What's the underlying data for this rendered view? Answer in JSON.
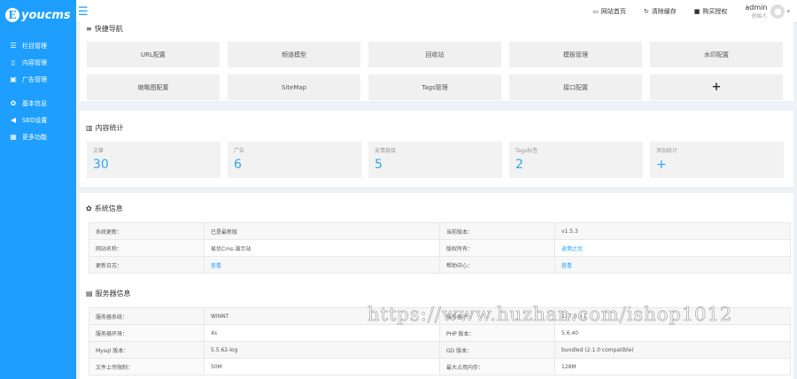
{
  "app": {
    "logo_letter": "E",
    "logo_text": "youcms"
  },
  "sidebar": {
    "group1": [
      {
        "icon": "list-icon",
        "label": "栏目管理"
      },
      {
        "icon": "file-icon",
        "label": "内容管理"
      },
      {
        "icon": "image-icon",
        "label": "广告管理"
      }
    ],
    "group2": [
      {
        "icon": "gear-icon",
        "label": "基本信息"
      },
      {
        "icon": "send-icon",
        "label": "SEO设置"
      },
      {
        "icon": "grid-icon",
        "label": "更多功能"
      }
    ]
  },
  "topbar": {
    "links": [
      {
        "icon": "monitor-icon",
        "label": "网站首页"
      },
      {
        "icon": "refresh-icon",
        "label": "清除缓存"
      },
      {
        "icon": "bookmark-icon",
        "label": "购买授权"
      }
    ],
    "user": {
      "name": "admin",
      "role": "创始人"
    }
  },
  "quick_nav": {
    "title": "快捷导航",
    "items": [
      "URL配置",
      "频道模型",
      "回收站",
      "模板管理",
      "水印配置",
      "缩略图配置",
      "SiteMap",
      "Tags管理",
      "接口配置",
      "+"
    ]
  },
  "content_stats": {
    "title": "内容统计",
    "cards": [
      {
        "label": "文章",
        "value": "30"
      },
      {
        "label": "广告",
        "value": "6"
      },
      {
        "label": "友情链接",
        "value": "5"
      },
      {
        "label": "Tags标签",
        "value": "2"
      },
      {
        "label": "添加统计",
        "value": "+"
      }
    ]
  },
  "system_info": {
    "title": "系统信息",
    "rows": [
      [
        "系统更新：",
        "已是最新版",
        "当前版本：",
        "v1.5.3"
      ],
      [
        "网站名称：",
        "易优Cms-演示站",
        "版权所有：",
        "返佣之优"
      ],
      [
        "更新日志：",
        "查看",
        "帮助中心：",
        "查看"
      ]
    ]
  },
  "server_info": {
    "title": "服务器信息",
    "rows": [
      [
        "服务器系统：",
        "WINNT",
        "服务器IP：",
        "127.0.0.1"
      ],
      [
        "服务器环境：",
        "4s",
        "PHP 版本：",
        "5.6.40"
      ],
      [
        "Mysql 版本：",
        "5.5.62-log",
        "GD 版本：",
        "bundled (2.1.0 compatible)"
      ],
      [
        "文件上传限制：",
        "50M",
        "最大占用内存：",
        "128M"
      ]
    ]
  },
  "watermark": "https://www.huzhan.com/ishop1012"
}
